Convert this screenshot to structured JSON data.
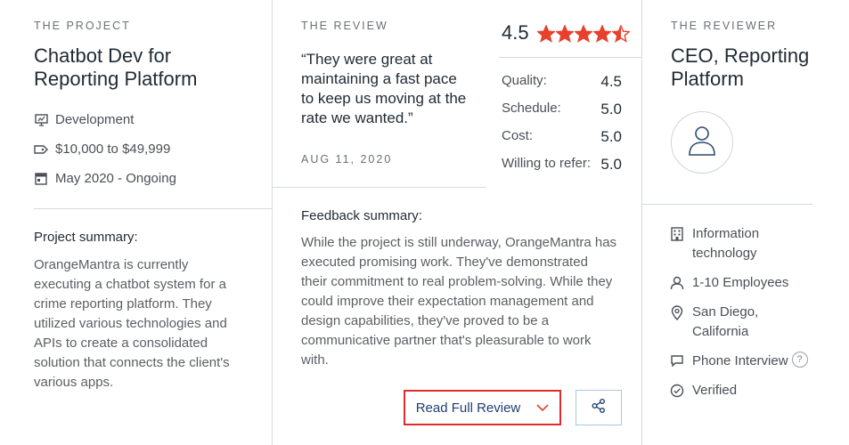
{
  "project": {
    "kicker": "THE PROJECT",
    "title_line1": "Chatbot Dev for",
    "title_line2": "Reporting Platform",
    "service": "Development",
    "budget": "$10,000 to $49,999",
    "timeline": "May 2020 - Ongoing",
    "summary_label": "Project summary:",
    "summary_lines": [
      "OrangeMantra is currently",
      "executing a chatbot system for a",
      "crime reporting platform. They",
      "utilized various technologies and",
      "APIs to create a consolidated",
      "solution that connects the client's",
      "various apps."
    ]
  },
  "review": {
    "kicker": "THE REVIEW",
    "quote_lines": [
      "“They were great at",
      "maintaining a fast pace",
      "to keep us moving at the",
      "rate we wanted.”"
    ],
    "date": "AUG 11, 2020",
    "overall_rating": "4.5",
    "stars_value": 4.5,
    "star_color": "#e8402c",
    "scores": [
      {
        "label": "Quality:",
        "value": "4.5"
      },
      {
        "label": "Schedule:",
        "value": "5.0"
      },
      {
        "label": "Cost:",
        "value": "5.0"
      },
      {
        "label": "Willing to refer:",
        "value": "5.0"
      }
    ],
    "feedback_label": "Feedback summary:",
    "feedback_lines": [
      "While the project is still underway, OrangeMantra has",
      "executed promising work. They've demonstrated",
      "their commitment to real problem-solving. While they",
      "could improve their expectation management and",
      "design capabilities, they've proved to be a",
      "communicative partner that's pleasurable to work",
      "with."
    ],
    "read_full_label": "Read Full Review",
    "highlight_color": "#e02b2b"
  },
  "reviewer": {
    "kicker": "THE REVIEWER",
    "title_line1": "CEO, Reporting",
    "title_line2": "Platform",
    "industry_line1": "Information",
    "industry_line2": "technology",
    "employees": "1-10 Employees",
    "location_line1": "San Diego,",
    "location_line2": "California",
    "interview": "Phone Interview",
    "interview_help": "?",
    "verified": "Verified"
  }
}
